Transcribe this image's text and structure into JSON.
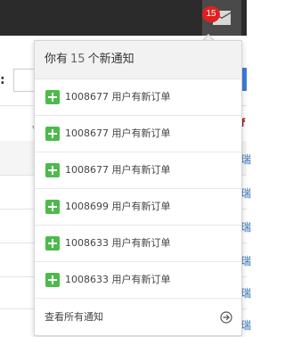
{
  "navbar": {
    "mail_icon": "envelope-icon",
    "badge_count": "15"
  },
  "background": {
    "colon": ":",
    "right_chars": [
      "瑞",
      "瑞",
      "瑞",
      "瑞",
      "瑞",
      "瑞"
    ],
    "right_header_char": "f"
  },
  "notifications": {
    "header_prefix": "你有",
    "header_count": "15",
    "header_suffix": "个新通知",
    "items": [
      {
        "icon": "plus-square-icon",
        "text": "1008677 用户有新订单"
      },
      {
        "icon": "plus-square-icon",
        "text": "1008677 用户有新订单"
      },
      {
        "icon": "plus-square-icon",
        "text": "1008677 用户有新订单"
      },
      {
        "icon": "plus-square-icon",
        "text": "1008699 用户有新订单"
      },
      {
        "icon": "plus-square-icon",
        "text": "1008633 用户有新订单"
      },
      {
        "icon": "plus-square-icon",
        "text": "1008633 用户有新订单"
      }
    ],
    "footer_label": "查看所有通知",
    "footer_icon": "arrow-right-circle-icon"
  },
  "colors": {
    "navbar": "#2b2b2b",
    "badge": "#e02020",
    "plus_icon": "#4cba4c",
    "header_bg": "#f2f2f2"
  }
}
